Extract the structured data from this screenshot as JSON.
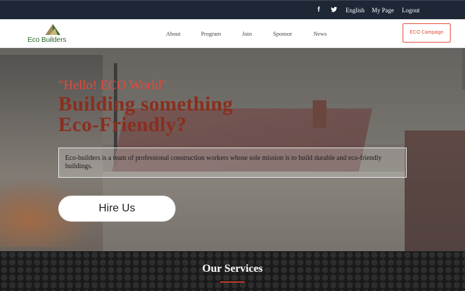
{
  "topbar": {
    "social": {
      "facebook_icon": "f",
      "twitter_icon": "twitter-icon"
    },
    "links": [
      "English",
      "My Page",
      "Logout"
    ]
  },
  "navbar": {
    "logo_text": "Eco Builders",
    "items": [
      "About",
      "Program",
      "Join",
      "Sponsor",
      "News"
    ],
    "campaign_button": "ECO Campaign"
  },
  "hero": {
    "greeting": "\"Hello! ECO World\"",
    "headline_line1": "Building something",
    "headline_line2": "Eco-Friendly?",
    "mission": "Eco-builders is a team of professional construction workers whose sole mission is to build durable and eco-friendly buildings.",
    "cta": "Hire Us"
  },
  "services": {
    "title": "Our Services"
  },
  "colors": {
    "topbar_bg": "#1d2736",
    "accent_red": "#e0503a",
    "headline": "#8a2e1e",
    "logo_green": "#2f6a2f"
  }
}
